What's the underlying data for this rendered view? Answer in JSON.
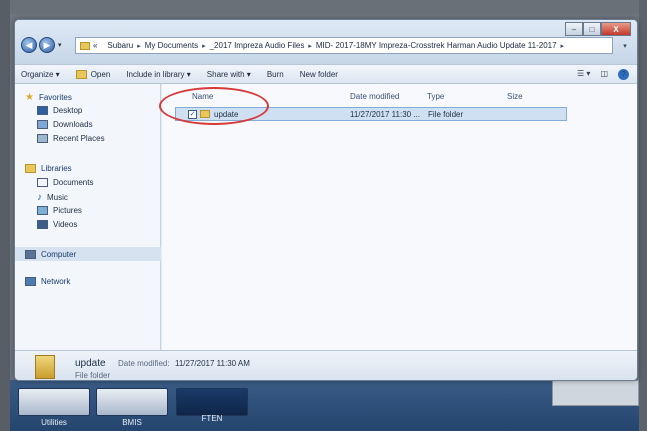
{
  "window": {
    "controls": {
      "minimize": "–",
      "maximize": "□",
      "close": "X"
    }
  },
  "address_bar": {
    "overflow": "«",
    "crumbs": [
      "Subaru",
      "My Documents",
      "_2017 Impreza Audio Files",
      "MID- 2017-18MY Impreza-Crosstrek Harman Audio Update 11-2017"
    ],
    "separator": "▸",
    "dropdown": "▾"
  },
  "toolbar": {
    "organize": "Organize ▾",
    "open": "Open",
    "include_in_library": "Include in library ▾",
    "share_with": "Share with ▾",
    "burn": "Burn",
    "new_folder": "New folder"
  },
  "nav_pane": {
    "favorites": "Favorites",
    "desktop": "Desktop",
    "downloads": "Downloads",
    "recent_places": "Recent Places",
    "libraries": "Libraries",
    "documents": "Documents",
    "music": "Music",
    "pictures": "Pictures",
    "videos": "Videos",
    "computer": "Computer",
    "network": "Network"
  },
  "columns": {
    "name": "Name",
    "date_modified": "Date modified",
    "type": "Type",
    "size": "Size"
  },
  "files": [
    {
      "name": "update",
      "date_modified": "11/27/2017 11:30 ...",
      "type": "File folder",
      "checked": "✓"
    }
  ],
  "details_pane": {
    "name": "update",
    "date_label": "Date modified:",
    "date_value": "11/27/2017 11:30 AM",
    "type": "File folder"
  },
  "desktop_icons": {
    "utilities": "Utilities",
    "bmis": "BMIS",
    "ften": "FTEN"
  },
  "colors": {
    "annotation": "#d63a3a",
    "selection": "#cfe0f3"
  }
}
